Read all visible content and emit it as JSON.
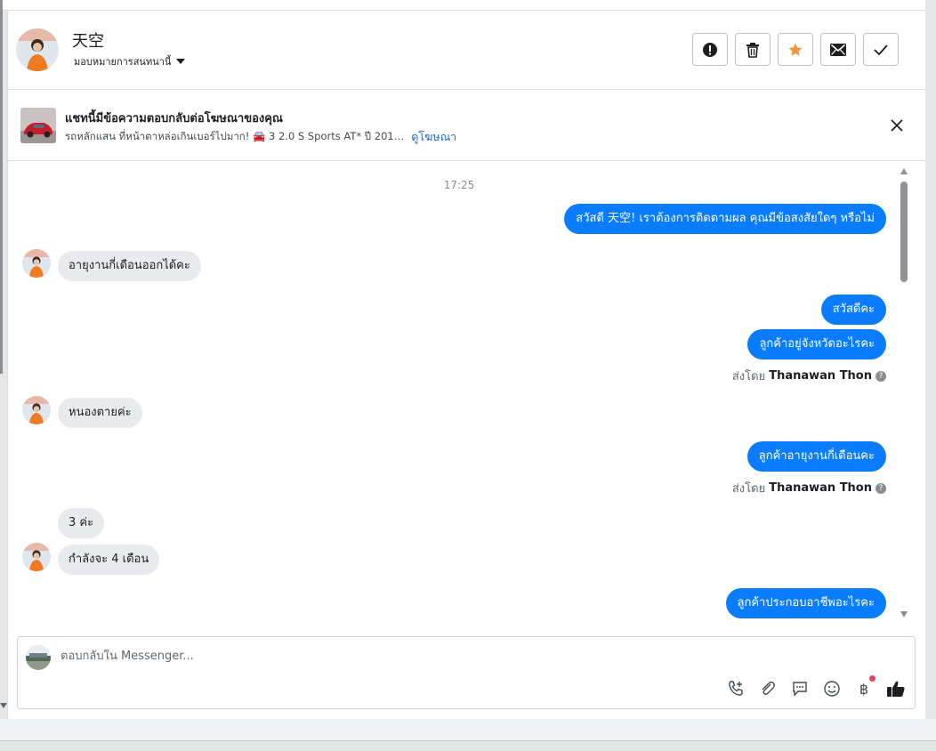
{
  "header": {
    "contact_name": "天空",
    "assign_label": "มอบหมายการสนทนานี้",
    "colors": {
      "star": "#f5923e",
      "icon": "#1c1e21"
    }
  },
  "ad_banner": {
    "title": "แชทนี้มีข้อความตอบกลับต่อโฆษณาของคุณ",
    "subtitle": "รถหลักแสน ที่หน้าตาหล่อเกินเบอร์ไปมาก! 🚘 3 2.0 S Sports AT* ปี 201…",
    "link_label": "ดูโฆษณา",
    "link_color": "#1c66c9"
  },
  "conversation": {
    "timestamp": "17:25",
    "bubble_out_color": "#0a7cff",
    "bubble_in_color": "#e9eaed",
    "messages": [
      {
        "from": "page",
        "text": "สวัสดี 天空! เราต้องการติดตามผล คุณมีข้อสงสัยใดๆ หรือไม่"
      },
      {
        "from": "customer",
        "text": "อายุงานกี่เดือนออกได้คะ"
      },
      {
        "from": "page",
        "text": "สวัสดีคะ"
      },
      {
        "from": "page",
        "text": "ลูกค้าอยู่จังหวัดอะไรคะ"
      },
      {
        "from": "customer",
        "text": "หนองตายค่ะ"
      },
      {
        "from": "page",
        "text": "ลูกค้าอายุงานกี่เดือนคะ"
      },
      {
        "from": "customer",
        "text": "3 ค่ะ"
      },
      {
        "from": "customer",
        "text": "กำลังจะ 4 เดือน"
      },
      {
        "from": "page",
        "text": "ลูกค้าประกอบอาชีพอะไรคะ"
      }
    ],
    "sent_by_prefix": "ส่งโดย",
    "sent_by_name": "Thanawan Thon",
    "sent_by_info": "?"
  },
  "composer": {
    "placeholder": "ตอบกลับใน Messenger...",
    "currency_symbol": "฿",
    "tools": [
      "call-add-icon",
      "attach-icon",
      "saved-reply-icon",
      "emoji-icon",
      "payment-icon",
      "like-icon"
    ]
  }
}
